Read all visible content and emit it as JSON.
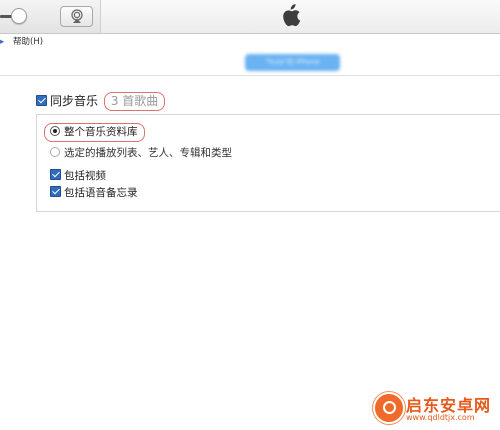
{
  "toolbar": {
    "volume_icon": "volume-slider-knob",
    "airplay_icon": "airplay-icon",
    "logo_icon": "apple-logo-icon"
  },
  "menubar": {
    "help": "帮助(H)"
  },
  "device": {
    "name": "\"hula\"的 iPhone"
  },
  "music_sync": {
    "checkbox_checked": true,
    "label": "同步音乐",
    "song_count": "3 首歌曲"
  },
  "sync_scope": {
    "entire_library_label": "整个音乐资料库",
    "entire_library_selected": true,
    "selected_items_label": "选定的播放列表、艺人、专辑和类型",
    "selected_items_selected": false
  },
  "options": {
    "include_videos_label": "包括视频",
    "include_videos_checked": true,
    "include_voice_memos_label": "包括语音备忘录",
    "include_voice_memos_checked": true
  },
  "watermark": {
    "title": "启东安卓网",
    "url": "www.qdldtjx.com"
  },
  "colors": {
    "highlight_outline": "#e0706d",
    "checkbox_blue": "#2f6dbf",
    "device_pill": "#6ab2f2",
    "watermark_orange": "#e55a1c"
  }
}
